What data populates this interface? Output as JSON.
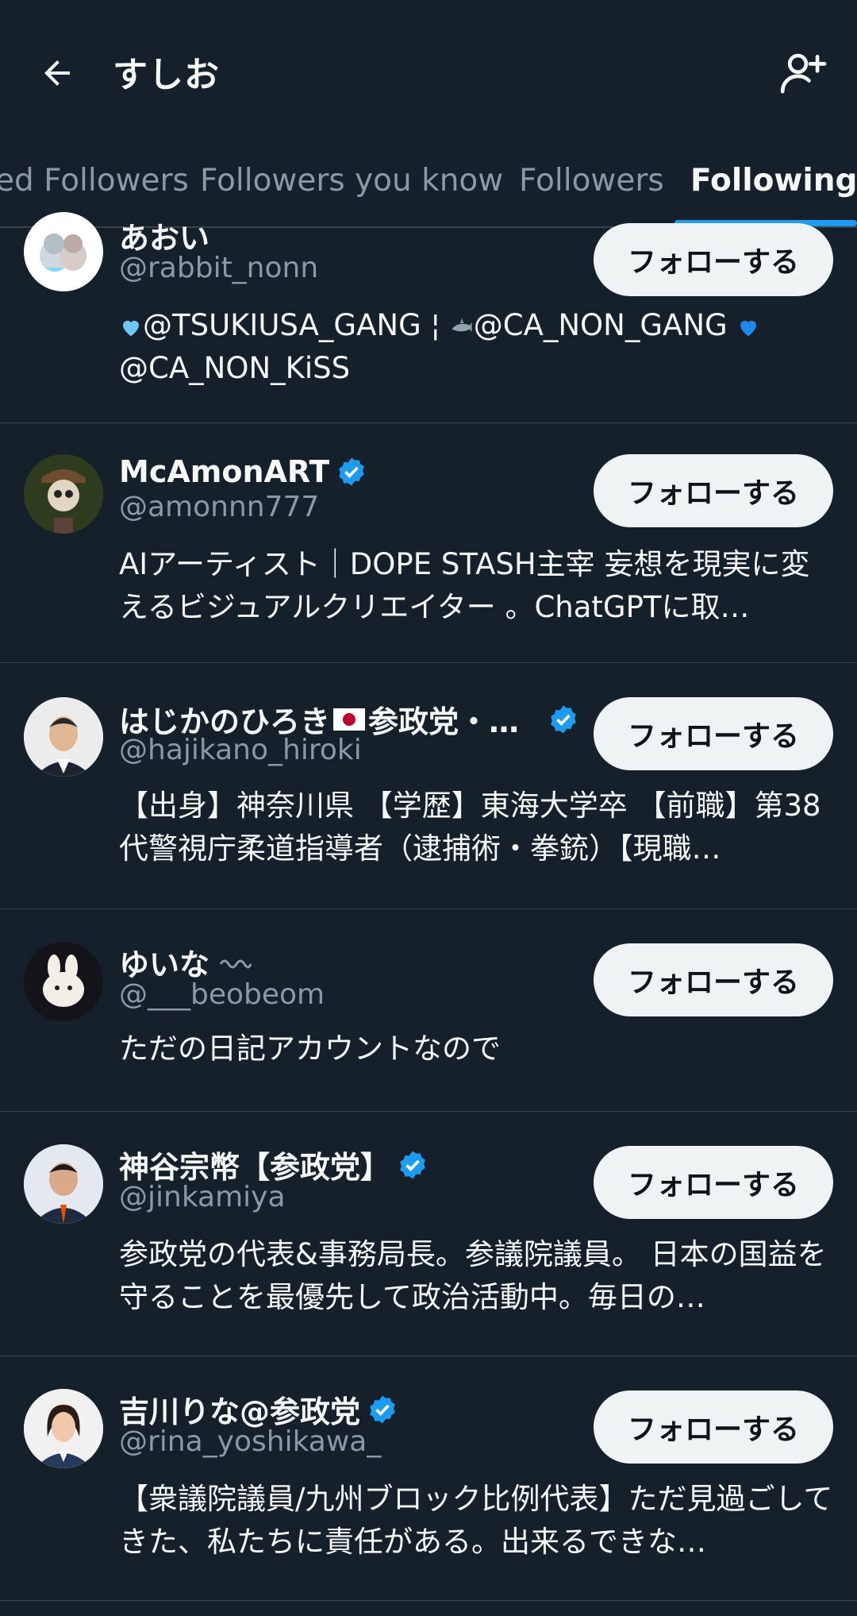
{
  "header": {
    "title": "すしお",
    "back_icon": "arrow-left-icon",
    "add_icon": "person-add-icon"
  },
  "tabs": [
    {
      "label": "ed Followers"
    },
    {
      "label": "Followers you know"
    },
    {
      "label": "Followers"
    },
    {
      "label": "Following",
      "active": true
    }
  ],
  "accent_color": "#1d9bf0",
  "users": [
    {
      "name": "あおい",
      "handle": "@rabbit_nonn",
      "verified": false,
      "bio_parts": [
        "@TSUKIUSA_GANG ¦ ",
        "@CA_NON_GANG ",
        "@CA_NON_KiSS"
      ],
      "follow_label": "フォローする"
    },
    {
      "name": "McAmonART",
      "handle": "@amonnn777",
      "verified": true,
      "bio": "AIアーティスト｜DOPE STASH主宰 妄想を現実に変えるビジュアルクリエイター 。ChatGPTに取…",
      "follow_label": "フォローする"
    },
    {
      "name_before_flag": "はじかのひろき",
      "name_after_flag": "参政党・…",
      "handle": "@hajikano_hiroki",
      "verified": true,
      "bio": "【出身】神奈川県 【学歴】東海大学卒 【前職】第38代警視庁柔道指導者（逮捕術・拳銃）【現職…",
      "follow_label": "フォローする"
    },
    {
      "name": "ゆいな",
      "handle": "@___beobeom",
      "verified": false,
      "bio": "ただの日記アカウントなので",
      "follow_label": "フォローする"
    },
    {
      "name": "神谷宗幣【参政党】",
      "handle": "@jinkamiya",
      "verified": true,
      "bio": "参政党の代表&事務局長。参議院議員。 日本の国益を守ることを最優先して政治活動中。毎日の…",
      "follow_label": "フォローする"
    },
    {
      "name": "吉川りな@参政党",
      "handle": "@rina_yoshikawa_",
      "verified": true,
      "bio": "【衆議院議員/九州ブロック比例代表】ただ見過ごしてきた、私たちに責任がある。出来るできな…",
      "follow_label": "フォローする"
    }
  ]
}
